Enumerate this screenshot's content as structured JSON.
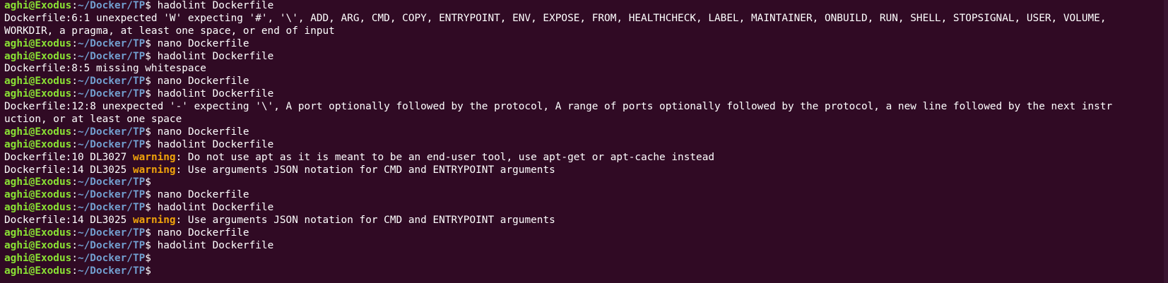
{
  "prompt": {
    "user": "aghi@Exodus",
    "sep": ":",
    "path": "~/Docker/TP",
    "symbol": "$ "
  },
  "lines": [
    {
      "type": "prompt",
      "cmd": "hadolint Dockerfile"
    },
    {
      "type": "text",
      "text": "Dockerfile:6:1 unexpected 'W' expecting '#', '\\', ADD, ARG, CMD, COPY, ENTRYPOINT, ENV, EXPOSE, FROM, HEALTHCHECK, LABEL, MAINTAINER, ONBUILD, RUN, SHELL, STOPSIGNAL, USER, VOLUME,"
    },
    {
      "type": "text",
      "text": "WORKDIR, a pragma, at least one space, or end of input"
    },
    {
      "type": "prompt",
      "cmd": "nano Dockerfile"
    },
    {
      "type": "prompt",
      "cmd": "hadolint Dockerfile"
    },
    {
      "type": "text",
      "text": "Dockerfile:8:5 missing whitespace"
    },
    {
      "type": "prompt",
      "cmd": "nano Dockerfile"
    },
    {
      "type": "prompt",
      "cmd": "hadolint Dockerfile"
    },
    {
      "type": "text",
      "text": "Dockerfile:12:8 unexpected '-' expecting '\\', A port optionally followed by the protocol, A range of ports optionally followed by the protocol, a new line followed by the next instr"
    },
    {
      "type": "text",
      "text": "uction, or at least one space"
    },
    {
      "type": "prompt",
      "cmd": "nano Dockerfile"
    },
    {
      "type": "prompt",
      "cmd": "hadolint Dockerfile"
    },
    {
      "type": "warning",
      "prefix": "Dockerfile:10 DL3027 ",
      "level": "warning",
      "msg": ": Do not use apt as it is meant to be an end-user tool, use apt-get or apt-cache instead"
    },
    {
      "type": "warning",
      "prefix": "Dockerfile:14 DL3025 ",
      "level": "warning",
      "msg": ": Use arguments JSON notation for CMD and ENTRYPOINT arguments"
    },
    {
      "type": "prompt",
      "cmd": ""
    },
    {
      "type": "prompt",
      "cmd": "nano Dockerfile"
    },
    {
      "type": "prompt",
      "cmd": "hadolint Dockerfile"
    },
    {
      "type": "warning",
      "prefix": "Dockerfile:14 DL3025 ",
      "level": "warning",
      "msg": ": Use arguments JSON notation for CMD and ENTRYPOINT arguments"
    },
    {
      "type": "prompt",
      "cmd": "nano Dockerfile"
    },
    {
      "type": "prompt",
      "cmd": "hadolint Dockerfile"
    },
    {
      "type": "prompt",
      "cmd": ""
    },
    {
      "type": "prompt",
      "cmd": ""
    }
  ],
  "colors": {
    "background": "#300a24",
    "user": "#8ae234",
    "path": "#729fcf",
    "warning": "#f0a30a",
    "text": "#ffffff"
  }
}
